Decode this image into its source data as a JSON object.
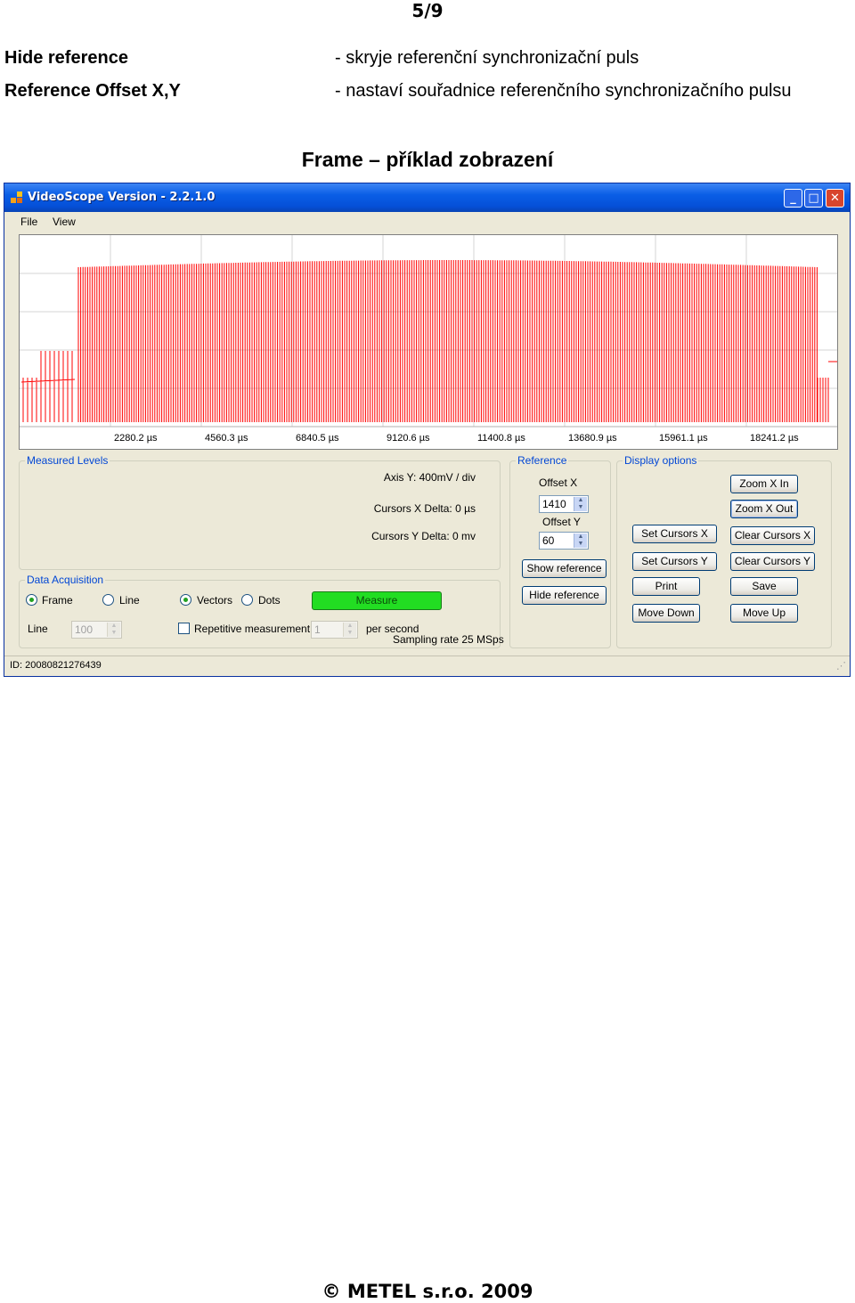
{
  "page_number": "5/9",
  "definitions": [
    {
      "term": "Hide reference",
      "desc": "- skryje referenční synchronizační puls"
    },
    {
      "term": "Reference Offset X,Y",
      "desc": "- nastaví souřadnice referenčního synchronizačního pulsu"
    }
  ],
  "caption": "Frame – příklad zobrazení",
  "window": {
    "title": "VideoScope Version - 2.2.1.0",
    "menu": {
      "file": "File",
      "view": "View"
    },
    "x_ticks": [
      "2280.2 µs",
      "4560.3 µs",
      "6840.5 µs",
      "9120.6 µs",
      "11400.8 µs",
      "13680.9 µs",
      "15961.1 µs",
      "18241.2 µs"
    ],
    "signal_color": "#ff0000",
    "measured": {
      "label": "Measured Levels",
      "axis_y": "Axis Y: 400mV / div",
      "cursors_x": "Cursors X Delta: 0 µs",
      "cursors_y": "Cursors Y Delta: 0 mv"
    },
    "reference": {
      "label": "Reference",
      "offset_x_label": "Offset X",
      "offset_x": "1410",
      "offset_y_label": "Offset Y",
      "offset_y": "60",
      "show": "Show reference",
      "hide": "Hide reference"
    },
    "display": {
      "label": "Display options",
      "zoom_in": "Zoom X In",
      "zoom_out": "Zoom X Out",
      "set_x": "Set Cursors X",
      "clear_x": "Clear Cursors X",
      "set_y": "Set Cursors Y",
      "clear_y": "Clear Cursors Y",
      "print": "Print",
      "save": "Save",
      "move_down": "Move Down",
      "move_up": "Move Up"
    },
    "acquisition": {
      "label": "Data Acquisition",
      "frame": "Frame",
      "line": "Line",
      "vectors": "Vectors",
      "dots": "Dots",
      "measure": "Measure",
      "line_label": "Line",
      "line_value": "100",
      "repetitive": "Repetitive measurement",
      "rep_value": "1",
      "per_second": "per second",
      "sampling": "Sampling rate 25 MSps"
    },
    "status_id": "ID: 20080821276439"
  },
  "footer": "© METEL s.r.o. 2009"
}
